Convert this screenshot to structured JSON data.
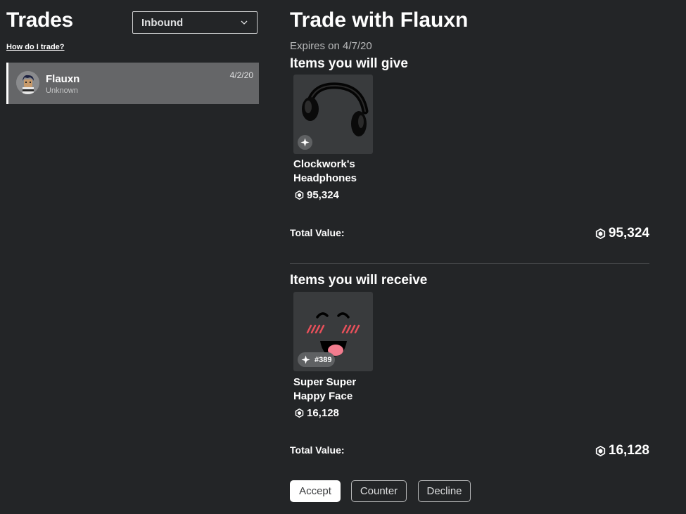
{
  "sidebar": {
    "title": "Trades",
    "filter_selected": "Inbound",
    "help_link": "How do I trade?",
    "trades": [
      {
        "name": "Flauxn",
        "status": "Unknown",
        "date": "4/2/20"
      }
    ]
  },
  "detail": {
    "title": "Trade with Flauxn",
    "expires": "Expires on 4/7/20",
    "give": {
      "heading": "Items you will give",
      "items": [
        {
          "name": "Clockwork's Headphones",
          "price": "95,324",
          "icon": "headphones-thumbnail"
        }
      ],
      "total_label": "Total Value:",
      "total_value": "95,324"
    },
    "receive": {
      "heading": "Items you will receive",
      "items": [
        {
          "name": "Super Super Happy Face",
          "price": "16,128",
          "serial": "#389",
          "icon": "happy-face-thumbnail"
        }
      ],
      "total_label": "Total Value:",
      "total_value": "16,128"
    }
  },
  "actions": {
    "accept": "Accept",
    "counter": "Counter",
    "decline": "Decline"
  },
  "colors": {
    "background": "#232527",
    "selected_row": "#656668",
    "card": "#393b3d",
    "blush": "#e8505b",
    "tongue": "#f27c8e"
  }
}
